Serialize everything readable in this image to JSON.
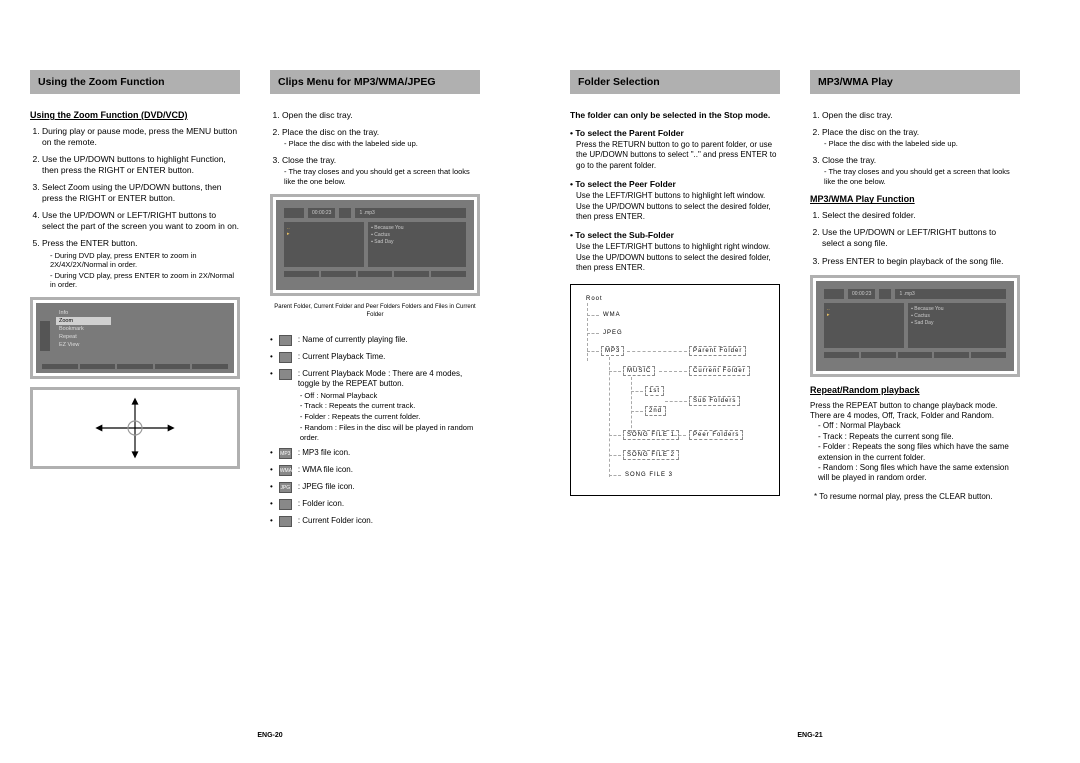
{
  "left": {
    "col1": {
      "header": "Using the Zoom Function",
      "sub": "Using the Zoom Function (DVD/VCD)",
      "steps": [
        "During play or pause mode, press the MENU button on the remote.",
        "Use the UP/DOWN buttons to highlight Function, then press the RIGHT or ENTER button.",
        "Select Zoom using the UP/DOWN buttons, then press the RIGHT or ENTER button.",
        "Use the UP/DOWN or LEFT/RIGHT buttons to select the part of the screen you want to zoom in on.",
        "Press the ENTER button."
      ],
      "sub5a": "- During DVD play, press ENTER to zoom in 2X/4X/2X/Normal in order.",
      "sub5b": "- During VCD play, press ENTER to zoom in 2X/Normal in order.",
      "osd": {
        "i1": "Info",
        "i2": "Zoom",
        "i3": "Bookmark",
        "i4": "Repeat",
        "i5": "EZ View"
      }
    },
    "col2": {
      "header": "Clips Menu for MP3/WMA/JPEG",
      "steps": [
        "Open the disc tray.",
        "Place the disc on the tray.",
        "Close the tray."
      ],
      "s2a": "- Place the disc with the labeled side up.",
      "s3a": "- The tray closes and you should get a screen that looks like the one below.",
      "cap": "Parent Folder, Current Folder and Peer Folders    Folders and Files in Current Folder",
      "leg": {
        "a": ": Name of currently playing file.",
        "b": ": Current Playback Time.",
        "c": ": Current Playback Mode : There are 4 modes, toggle by the REPEAT button.",
        "c1": "- Off : Normal Playback",
        "c2": "- Track : Repeats the current track.",
        "c3": "- Folder : Repeats the current folder.",
        "c4": "- Random : Files in the disc will be played in random order.",
        "d": ": MP3 file icon.",
        "e": ": WMA file icon.",
        "f": ": JPEG file icon.",
        "g": ": Folder icon.",
        "h": ": Current Folder icon."
      },
      "screen": {
        "time": "00:00:23",
        "title": "1 .mp3",
        "f1": "Because You",
        "f2": "Cactus",
        "f3": "Sad Day"
      }
    },
    "pgnum": "ENG-20"
  },
  "right": {
    "col1": {
      "header": "Folder Selection",
      "intro": "The folder can only be selected in the Stop mode.",
      "b1h": "• To select the Parent Folder",
      "b1": "Press the RETURN button to go to parent folder, or use the UP/DOWN buttons to select \"..\" and press ENTER to go to the parent folder.",
      "b2h": "• To select the Peer Folder",
      "b2": "Use the LEFT/RIGHT buttons to highlight left window. Use the UP/DOWN buttons to select the desired folder, then press ENTER.",
      "b3h": "• To select the Sub-Folder",
      "b3": "Use the LEFT/RIGHT buttons to highlight right window. Use the UP/DOWN buttons to select the desired folder, then press ENTER.",
      "tree": {
        "root": "Root",
        "wma": "WMA",
        "jpeg": "JPEG",
        "mp3": "MP3",
        "music": "MUSIC",
        "n1": "1st",
        "n2": "2nd",
        "s1": "SONG FILE 1",
        "s2": "SONG FILE 2",
        "s3": "SONG FILE 3",
        "parent": "Parent Folder",
        "current": "Current Folder",
        "sub": "Sub Folders",
        "peer": "Peer Folders"
      }
    },
    "col2": {
      "header": "MP3/WMA Play",
      "steps": [
        "Open the disc tray.",
        "Place the disc on the tray.",
        "Close the tray."
      ],
      "s2a": "- Place the disc with the labeled side up.",
      "s3a": "- The tray closes and you should get a screen that looks like the one below.",
      "sub": "MP3/WMA Play Function",
      "steps2": [
        "Select the desired folder.",
        "Use the UP/DOWN or LEFT/RIGHT buttons to select a song file.",
        "Press ENTER to begin playback of the song file."
      ],
      "sub2": "Repeat/Random playback",
      "rp": "Press the REPEAT button to change playback mode. There are 4 modes, Off, Track, Folder and Random.",
      "r1": "- Off : Normal Playback",
      "r2": "- Track : Repeats the current song file.",
      "r3": "- Folder : Repeats the song files which have the same extension in the current folder.",
      "r4": "- Random : Song files which have the same extension will be played in random order.",
      "note": "* To resume normal play, press the CLEAR button.",
      "screen": {
        "time": "00:00:23",
        "title": "1 .mp3",
        "f1": "Because You",
        "f2": "Cactus",
        "f3": "Sad Day"
      }
    },
    "pgnum": "ENG-21"
  }
}
